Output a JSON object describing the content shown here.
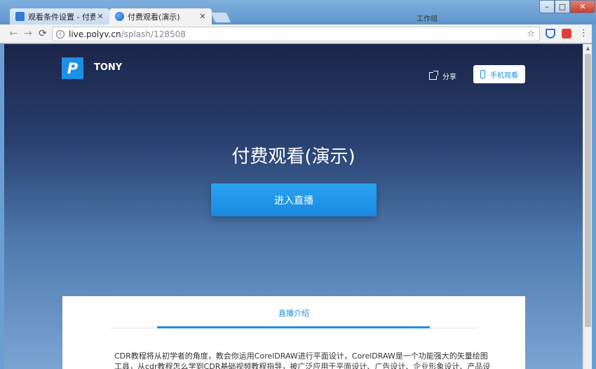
{
  "browser": {
    "tabs": [
      {
        "title": "观看条件设置 - 付费观看",
        "state": "inactive"
      },
      {
        "title": "付费观看(演示)",
        "state": "active"
      }
    ],
    "tab_close_glyph": "✕",
    "profile_label": "工作组",
    "window_controls": {
      "minimize": "–",
      "maximize": "□",
      "close": "✕"
    },
    "url": {
      "host": "live.polyv.cn",
      "path": "/splash/128508"
    },
    "nav": {
      "back": "←",
      "forward": "→",
      "reload": "⟳",
      "star": "☆",
      "menu": "⋮",
      "info": "i",
      "scroll_up": "▲"
    }
  },
  "page": {
    "logo_letter": "P",
    "channel_name": "TONY",
    "share_label": "分享",
    "mobile_watch_label": "手机观看",
    "headline": "付费观看(演示)",
    "enter_button": "进入直播",
    "intro_tab": "直播介绍",
    "intro_text": "CDR教程将从初学者的角度，教会你运用CorelDRAW进行平面设计，CorelDRAW是一个功能强大的矢量绘图工具，从cdr教程怎么学到CDR基础视频教程指导，被广泛应用于平面设计、广告设计、企业形象设计、产品设计"
  },
  "colors": {
    "accent": "#1e8fe6",
    "hero_top": "#1b2448",
    "hero_bottom": "#7aa5d3"
  }
}
